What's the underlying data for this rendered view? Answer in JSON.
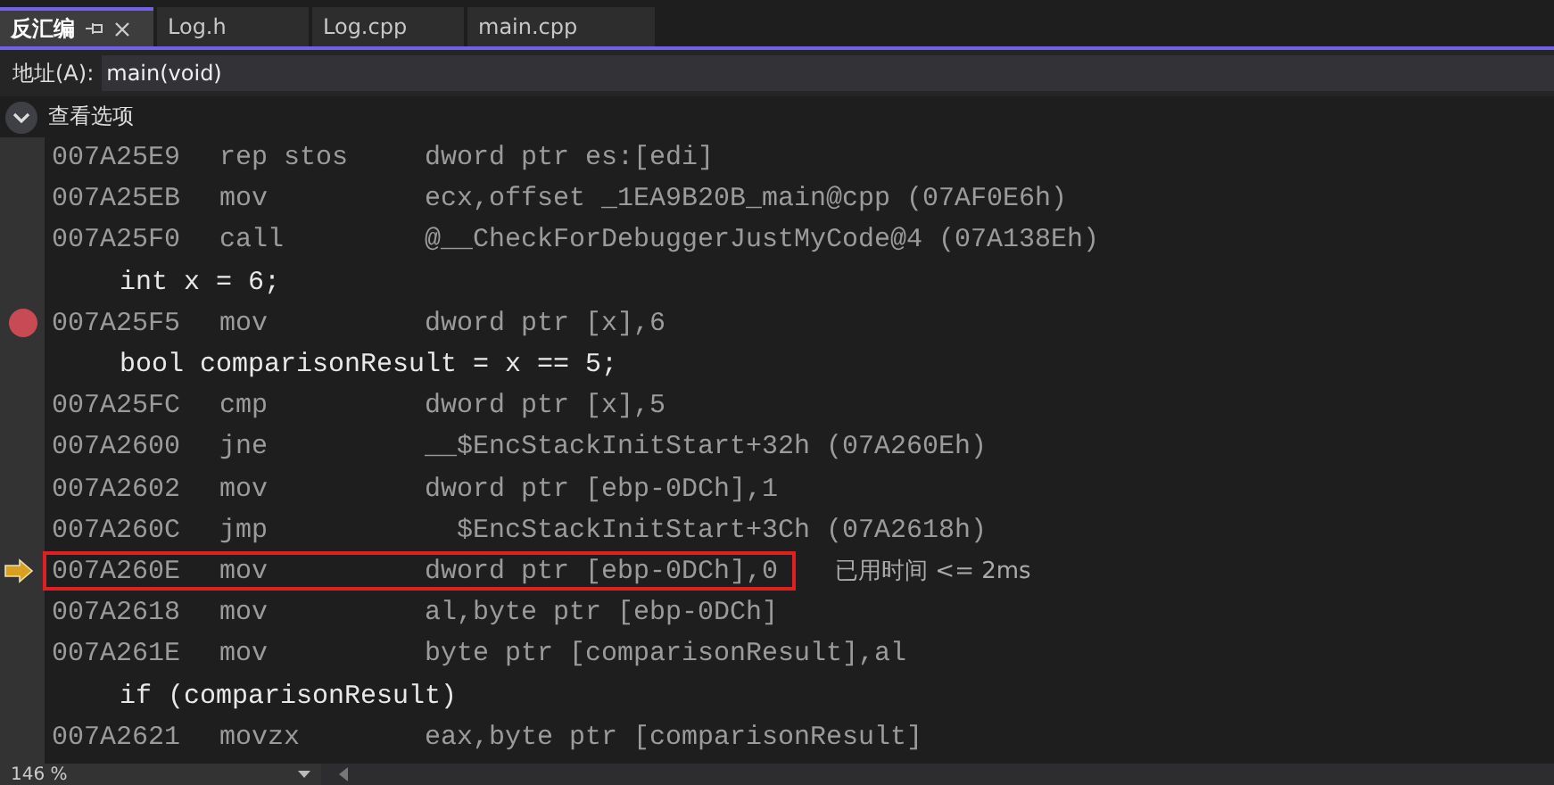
{
  "tabs": [
    {
      "label": "反汇编",
      "selected": true,
      "pinned": true
    },
    {
      "label": "Log.h",
      "selected": false,
      "pinned": false
    },
    {
      "label": "Log.cpp",
      "selected": false,
      "pinned": false
    },
    {
      "label": "main.cpp",
      "selected": false,
      "pinned": false
    }
  ],
  "address": {
    "label": "地址(A):",
    "value": "main(void)"
  },
  "options": {
    "label": "查看选项",
    "expanded": false
  },
  "lines": [
    {
      "kind": "asm",
      "address": "007A25E9",
      "op": "rep stos",
      "args": "dword ptr es:[edi]",
      "breakpoint": false,
      "current": false
    },
    {
      "kind": "asm",
      "address": "007A25EB",
      "op": "mov",
      "args": "ecx,offset _1EA9B20B_main@cpp (07AF0E6h)",
      "breakpoint": false,
      "current": false
    },
    {
      "kind": "asm",
      "address": "007A25F0",
      "op": "call",
      "args": "@__CheckForDebuggerJustMyCode@4 (07A138Eh)",
      "breakpoint": false,
      "current": false
    },
    {
      "kind": "source",
      "text": "int x = 6;"
    },
    {
      "kind": "asm",
      "address": "007A25F5",
      "op": "mov",
      "args": "dword ptr [x],6",
      "breakpoint": true,
      "current": false
    },
    {
      "kind": "source",
      "text": "bool comparisonResult = x == 5;"
    },
    {
      "kind": "asm",
      "address": "007A25FC",
      "op": "cmp",
      "args": "dword ptr [x],5",
      "breakpoint": false,
      "current": false
    },
    {
      "kind": "asm",
      "address": "007A2600",
      "op": "jne",
      "args": "__$EncStackInitStart+32h (07A260Eh)",
      "breakpoint": false,
      "current": false
    },
    {
      "kind": "asm",
      "address": "007A2602",
      "op": "mov",
      "args": "dword ptr [ebp-0DCh],1",
      "breakpoint": false,
      "current": false
    },
    {
      "kind": "asm",
      "address": "007A260C",
      "op": "jmp",
      "args": "  $EncStackInitStart+3Ch (07A2618h)",
      "breakpoint": false,
      "current": false
    },
    {
      "kind": "asm",
      "address": "007A260E",
      "op": "mov",
      "args": "dword ptr [ebp-0DCh],0",
      "breakpoint": false,
      "current": true,
      "elapsed": "已用时间 <= 2ms"
    },
    {
      "kind": "asm",
      "address": "007A2618",
      "op": "mov",
      "args": "al,byte ptr [ebp-0DCh]",
      "breakpoint": false,
      "current": false
    },
    {
      "kind": "asm",
      "address": "007A261E",
      "op": "mov",
      "args": "byte ptr [comparisonResult],al",
      "breakpoint": false,
      "current": false
    },
    {
      "kind": "source",
      "text": "if (comparisonResult)"
    },
    {
      "kind": "asm",
      "address": "007A2621",
      "op": "movzx",
      "args": "eax,byte ptr [comparisonResult]",
      "breakpoint": false,
      "current": false
    }
  ],
  "zoom": "146 %"
}
